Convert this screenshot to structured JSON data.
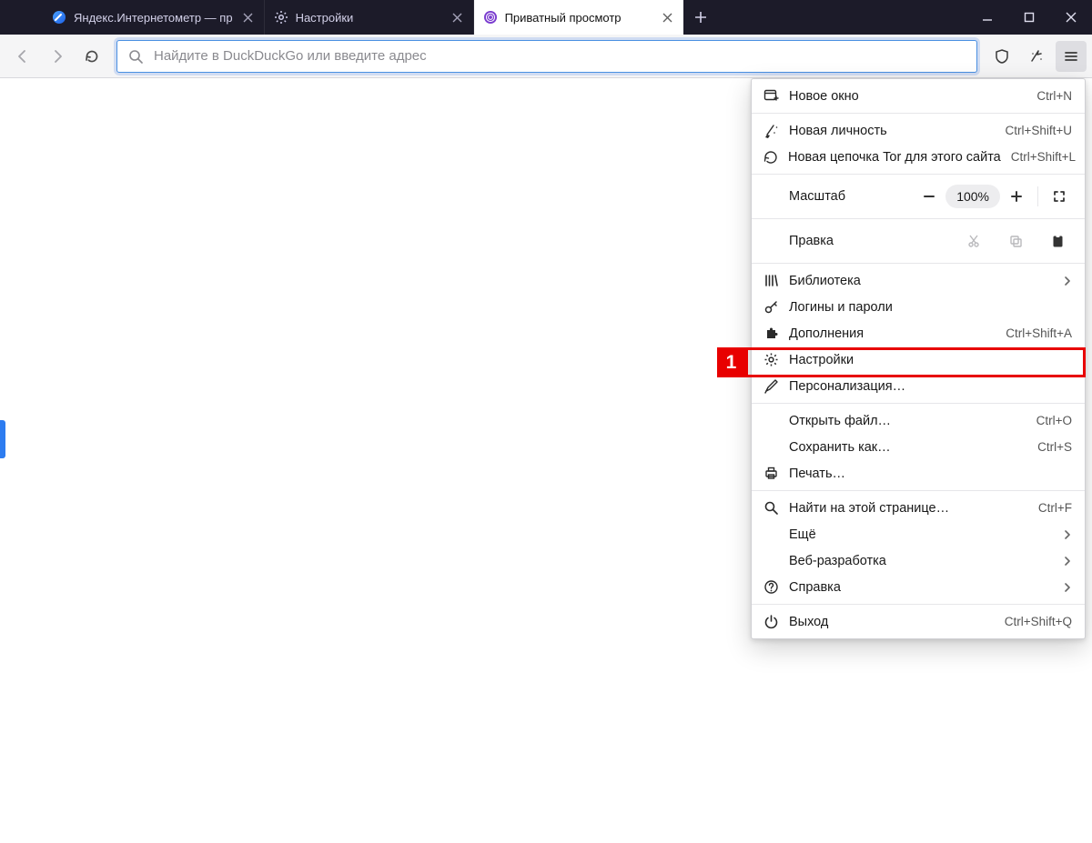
{
  "tabs": [
    {
      "title": "Яндекс.Интернетометр — пр"
    },
    {
      "title": "Настройки"
    },
    {
      "title": "Приватный просмотр"
    }
  ],
  "urlbar": {
    "placeholder": "Найдите в DuckDuckGo или введите адрес"
  },
  "menu": {
    "new_window": {
      "label": "Новое окно",
      "shortcut": "Ctrl+N"
    },
    "new_identity": {
      "label": "Новая личность",
      "shortcut": "Ctrl+Shift+U"
    },
    "new_circuit": {
      "label": "Новая цепочка Tor для этого сайта",
      "shortcut": "Ctrl+Shift+L"
    },
    "zoom": {
      "label": "Масштаб",
      "value": "100%"
    },
    "edit": {
      "label": "Правка"
    },
    "library": {
      "label": "Библиотека"
    },
    "logins": {
      "label": "Логины и пароли"
    },
    "addons": {
      "label": "Дополнения",
      "shortcut": "Ctrl+Shift+A"
    },
    "settings": {
      "label": "Настройки"
    },
    "customize": {
      "label": "Персонализация…"
    },
    "open_file": {
      "label": "Открыть файл…",
      "shortcut": "Ctrl+O"
    },
    "save_as": {
      "label": "Сохранить как…",
      "shortcut": "Ctrl+S"
    },
    "print": {
      "label": "Печать…"
    },
    "find": {
      "label": "Найти на этой странице…",
      "shortcut": "Ctrl+F"
    },
    "more": {
      "label": "Ещё"
    },
    "webdev": {
      "label": "Веб-разработка"
    },
    "help": {
      "label": "Справка"
    },
    "quit": {
      "label": "Выход",
      "shortcut": "Ctrl+Shift+Q"
    }
  },
  "annotation": {
    "number": "1"
  }
}
